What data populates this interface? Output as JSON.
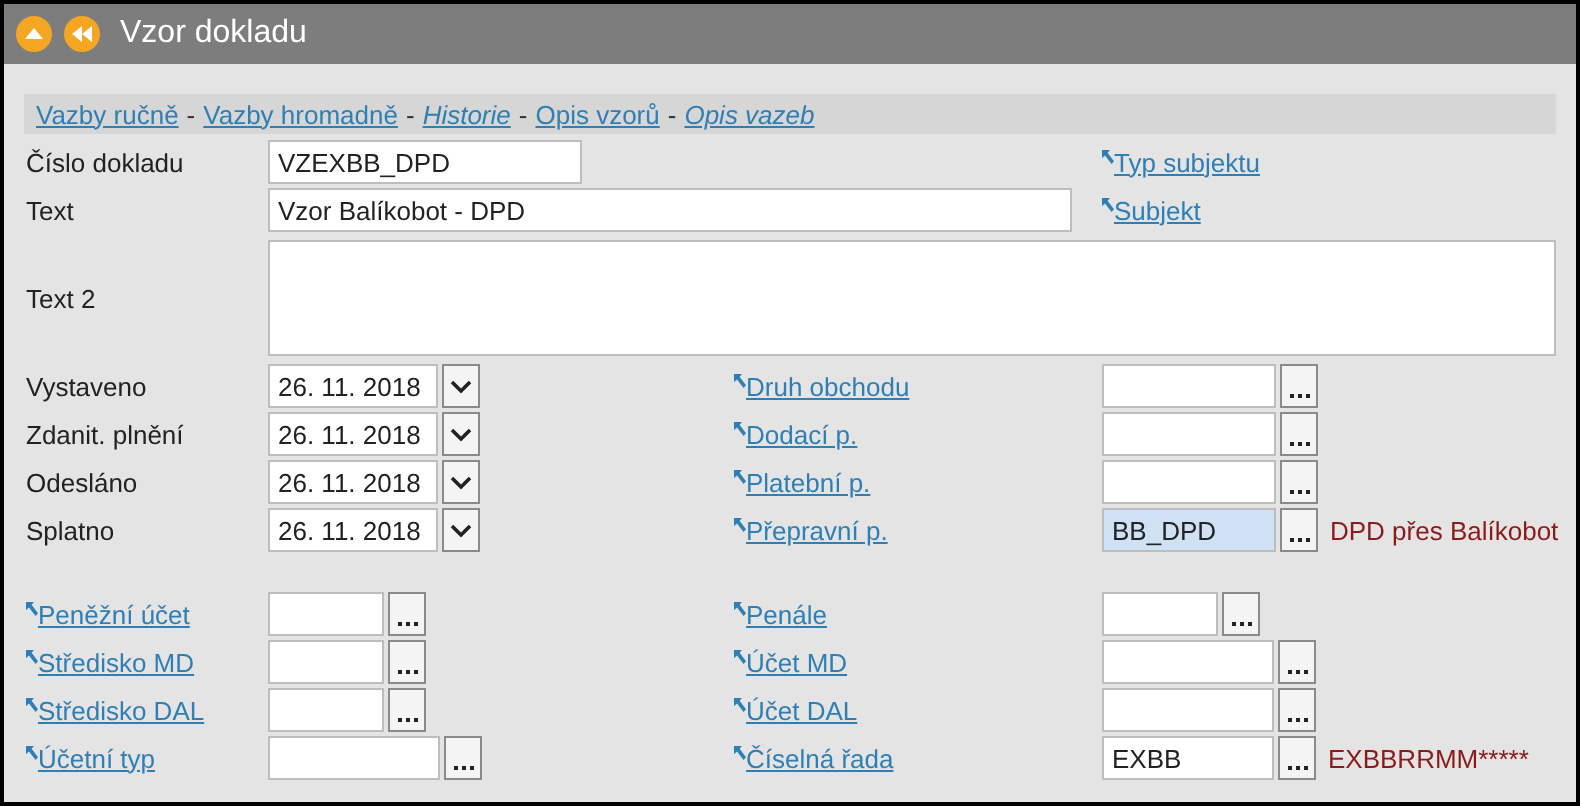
{
  "window": {
    "title": "Vzor dokladu"
  },
  "link_bar": [
    {
      "label": "Vazby ručně",
      "italic": false
    },
    {
      "separator": "-",
      "label": "Vazby hromadně",
      "italic": false
    },
    {
      "separator": "-",
      "label": "Historie",
      "italic": true
    },
    {
      "separator": "-",
      "label": "Opis vzorů",
      "italic": false
    },
    {
      "separator": "-",
      "label": "Opis vazeb",
      "italic": true
    }
  ],
  "header_rows": [
    {
      "label": "Číslo dokladu",
      "kind": "code",
      "value": "VZEXBB_DPD",
      "link": "Typ subjektu"
    },
    {
      "label": "Text",
      "kind": "text",
      "value": "Vzor Balíkobot - DPD",
      "link": "Subjekt"
    }
  ],
  "text2": {
    "label": "Text 2"
  },
  "date_rows": [
    {
      "label": "Vystaveno",
      "value": "26. 11. 2018",
      "right": {
        "link": "Druh obchodu",
        "highlighted": false
      }
    },
    {
      "label": "Zdanit. plnění",
      "value": "26. 11. 2018",
      "right": {
        "link": "Dodací p.",
        "highlighted": false
      }
    },
    {
      "label": "Odesláno",
      "value": "26. 11. 2018",
      "right": {
        "link": "Platební p.",
        "highlighted": false
      }
    },
    {
      "label": "Splatno",
      "value": "26. 11. 2018",
      "right": {
        "link": "Přepravní p.",
        "value": "BB_DPD",
        "highlighted": true,
        "description": "DPD přes Balíkobot"
      }
    }
  ],
  "account_rows": [
    {
      "left": {
        "link": "Peněžní účet",
        "kind": "short"
      },
      "right": {
        "link": "Penále",
        "kind": "short",
        "highlighted": false
      }
    },
    {
      "left": {
        "link": "Středisko MD",
        "kind": "short"
      },
      "right": {
        "link": "Účet MD",
        "kind": "long",
        "highlighted": false
      }
    },
    {
      "left": {
        "link": "Středisko DAL",
        "kind": "short"
      },
      "right": {
        "link": "Účet DAL",
        "kind": "long",
        "highlighted": false
      }
    },
    {
      "left": {
        "link": "Účetní typ",
        "kind": "long"
      },
      "right": {
        "link": "Číselná řada",
        "kind": "long",
        "value": "EXBB",
        "highlighted": false,
        "description": "EXBBRRMM*****"
      }
    }
  ]
}
